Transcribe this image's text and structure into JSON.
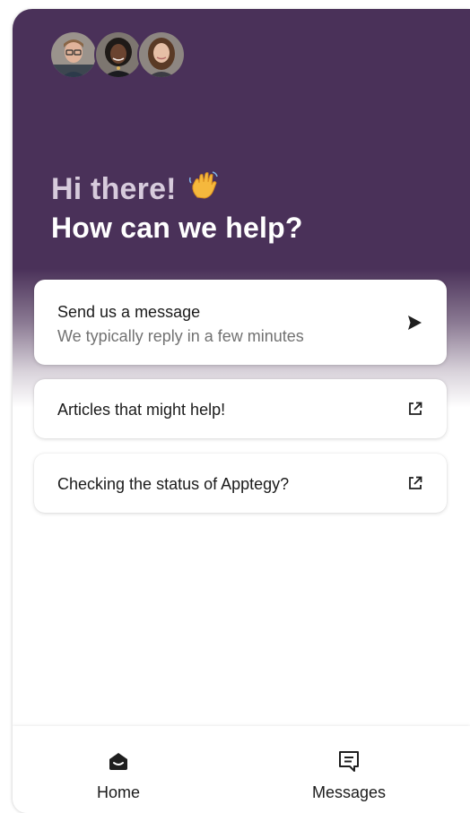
{
  "greeting": "Hi there!",
  "subheading": "How can we help?",
  "avatars": [
    {
      "name": "avatar-1"
    },
    {
      "name": "avatar-2"
    },
    {
      "name": "avatar-3"
    }
  ],
  "cards": {
    "message": {
      "title": "Send us a message",
      "subtitle": "We typically reply in a few minutes",
      "icon": "send-arrow-icon"
    },
    "articles": {
      "title": "Articles that might help!",
      "icon": "external-link-icon"
    },
    "status": {
      "title": "Checking the status of Apptegy?",
      "icon": "external-link-icon"
    }
  },
  "nav": {
    "home_label": "Home",
    "messages_label": "Messages"
  },
  "colors": {
    "brand": "#4a3159",
    "greeting_text": "#d7cbdc",
    "body_text": "#1b1b1b",
    "muted_text": "#727272"
  }
}
